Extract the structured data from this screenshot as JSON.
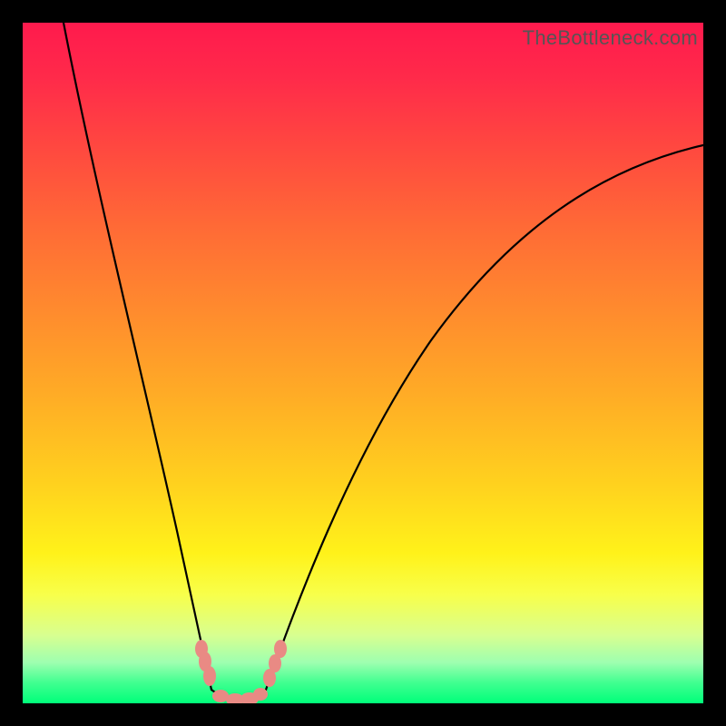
{
  "watermark": "TheBottleneck.com",
  "chart_data": {
    "type": "line",
    "title": "",
    "xlabel": "",
    "ylabel": "",
    "xlim": [
      0,
      100
    ],
    "ylim": [
      0,
      100
    ],
    "series": [
      {
        "name": "left-branch",
        "x": [
          6,
          10,
          14,
          18,
          22,
          24,
          26,
          27
        ],
        "y": [
          100,
          74,
          52,
          34,
          18,
          10,
          3,
          0
        ]
      },
      {
        "name": "valley-floor",
        "x": [
          27,
          30,
          33,
          35
        ],
        "y": [
          0,
          0,
          0,
          0
        ]
      },
      {
        "name": "right-branch",
        "x": [
          35,
          40,
          46,
          54,
          64,
          76,
          88,
          100
        ],
        "y": [
          0,
          10,
          24,
          40,
          56,
          68,
          77,
          82
        ]
      }
    ],
    "annotations": [
      {
        "name": "bead-cluster-left",
        "x": 26,
        "y": 4
      },
      {
        "name": "bead-cluster-bottom",
        "x": 31,
        "y": 0
      },
      {
        "name": "bead-cluster-right",
        "x": 36,
        "y": 4
      }
    ],
    "background_gradient": {
      "top": "#ff1a4d",
      "mid": "#ffd21e",
      "bottom": "#00ff7a"
    }
  }
}
